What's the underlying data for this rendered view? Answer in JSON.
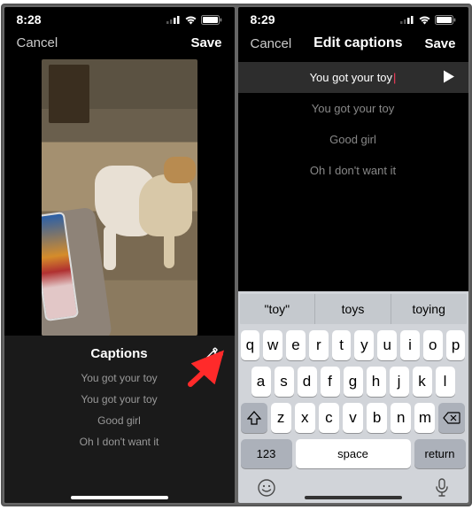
{
  "left": {
    "time": "8:28",
    "cancel": "Cancel",
    "save": "Save",
    "captions_title": "Captions",
    "captions": [
      "You got your toy",
      "You got your toy",
      "Good girl",
      "Oh I don't want it"
    ]
  },
  "right": {
    "time": "8:29",
    "cancel": "Cancel",
    "title": "Edit captions",
    "save": "Save",
    "captions": [
      "You got your toy",
      "You got your toy",
      "Good girl",
      "Oh I don't want it"
    ],
    "active_index": 0,
    "suggestions": [
      "\"toy\"",
      "toys",
      "toying"
    ],
    "row1": [
      "q",
      "w",
      "e",
      "r",
      "t",
      "y",
      "u",
      "i",
      "o",
      "p"
    ],
    "row2": [
      "a",
      "s",
      "d",
      "f",
      "g",
      "h",
      "j",
      "k",
      "l"
    ],
    "row3": [
      "z",
      "x",
      "c",
      "v",
      "b",
      "n",
      "m"
    ],
    "key123": "123",
    "space": "space",
    "return": "return"
  }
}
